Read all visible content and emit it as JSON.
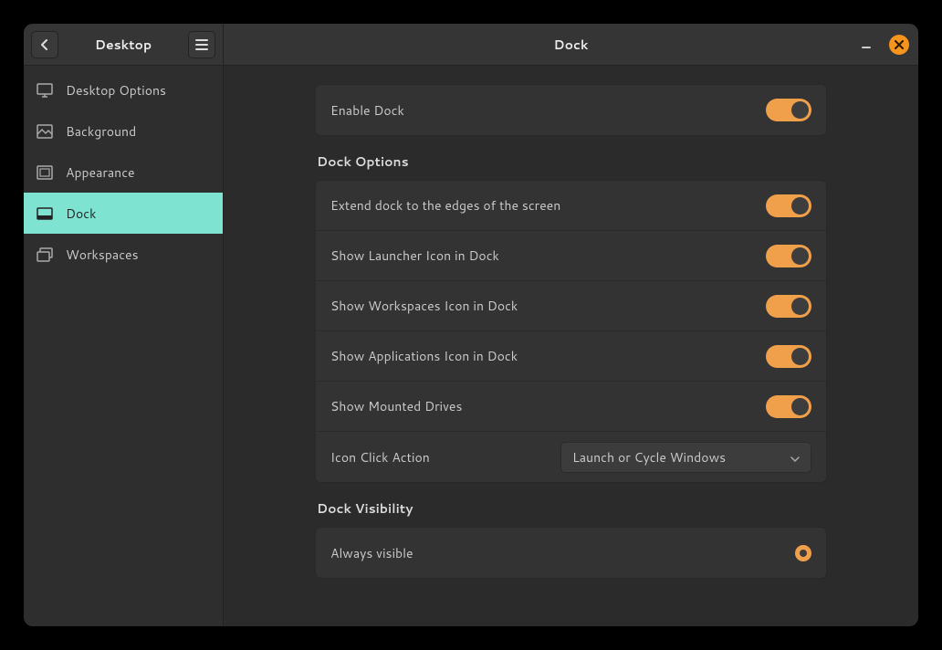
{
  "sidebar": {
    "title": "Desktop",
    "items": [
      {
        "label": "Desktop Options"
      },
      {
        "label": "Background"
      },
      {
        "label": "Appearance"
      },
      {
        "label": "Dock"
      },
      {
        "label": "Workspaces"
      }
    ]
  },
  "main": {
    "title": "Dock"
  },
  "enable_dock": {
    "label": "Enable Dock",
    "value": true
  },
  "dock_options": {
    "title": "Dock Options",
    "rows": {
      "extend": {
        "label": "Extend dock to the edges of the screen",
        "value": true
      },
      "launcher": {
        "label": "Show Launcher Icon in Dock",
        "value": true
      },
      "workspaces": {
        "label": "Show Workspaces Icon in Dock",
        "value": true
      },
      "applications": {
        "label": "Show Applications Icon in Dock",
        "value": true
      },
      "mounted": {
        "label": "Show Mounted Drives",
        "value": true
      },
      "click_action": {
        "label": "Icon Click Action",
        "selected": "Launch or Cycle Windows"
      }
    }
  },
  "dock_visibility": {
    "title": "Dock Visibility",
    "always_visible": {
      "label": "Always visible",
      "selected": true
    }
  }
}
